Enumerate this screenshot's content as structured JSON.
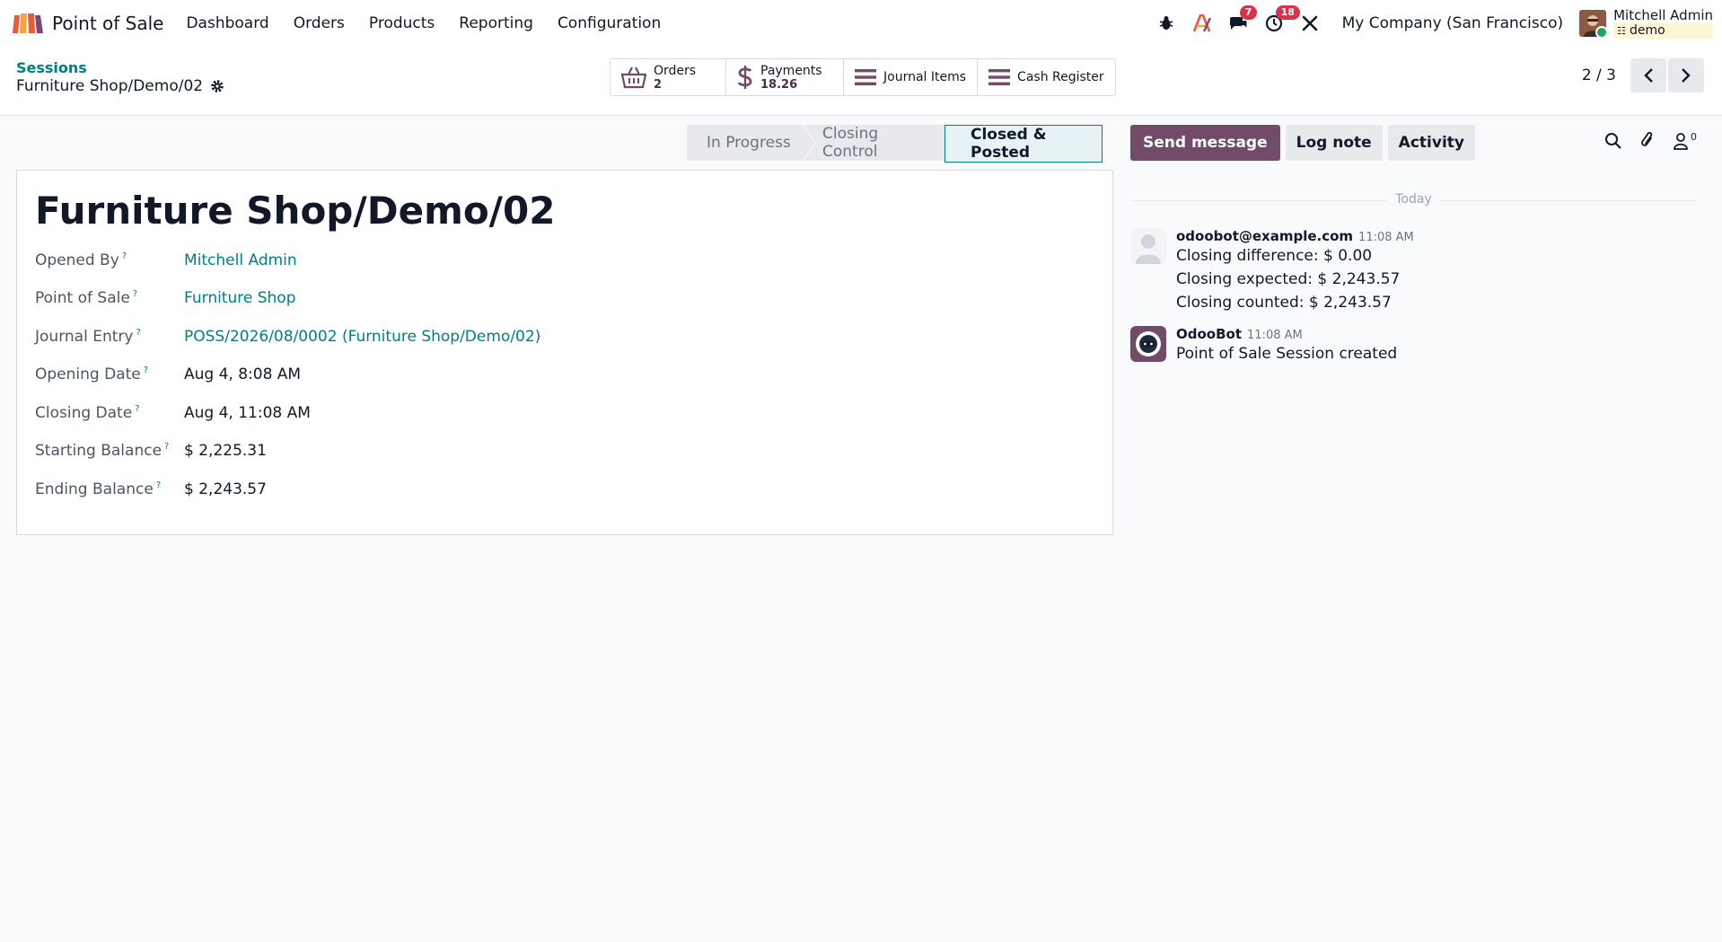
{
  "navbar": {
    "app_name": "Point of Sale",
    "menu": [
      "Dashboard",
      "Orders",
      "Products",
      "Reporting",
      "Configuration"
    ],
    "messages_badge": "7",
    "activities_badge": "18",
    "company": "My Company (San Francisco)",
    "user_name": "Mitchell Admin",
    "database": "demo"
  },
  "control_panel": {
    "breadcrumb_parent": "Sessions",
    "breadcrumb_current": "Furniture Shop/Demo/02",
    "smart_buttons": {
      "orders": {
        "label": "Orders",
        "value": "2"
      },
      "payments": {
        "label": "Payments",
        "value": "18.26"
      },
      "journal_items": {
        "label": "Journal Items"
      },
      "cash_register": {
        "label": "Cash Register"
      }
    },
    "pager": "2 / 3"
  },
  "statusbar": {
    "stages": [
      "In Progress",
      "Closing Control",
      "Closed & Posted"
    ],
    "active": "Closed & Posted"
  },
  "form": {
    "title": "Furniture Shop/Demo/02",
    "fields": {
      "opened_by": {
        "label": "Opened By",
        "value": "Mitchell Admin"
      },
      "point_of_sale": {
        "label": "Point of Sale",
        "value": "Furniture Shop"
      },
      "journal_entry": {
        "label": "Journal Entry",
        "value": "POSS/2026/08/0002 (Furniture Shop/Demo/02)"
      },
      "opening_date": {
        "label": "Opening Date",
        "value": "Aug 4, 8:08 AM"
      },
      "closing_date": {
        "label": "Closing Date",
        "value": "Aug 4, 11:08 AM"
      },
      "starting_balance": {
        "label": "Starting Balance",
        "value": "$ 2,225.31"
      },
      "ending_balance": {
        "label": "Ending Balance",
        "value": "$ 2,243.57"
      }
    },
    "help_marker": "?"
  },
  "chatter": {
    "send_message": "Send message",
    "log_note": "Log note",
    "activity": "Activity",
    "followers_count": "0",
    "date_separator": "Today",
    "messages": [
      {
        "author": "odoobot@example.com",
        "time": "11:08 AM",
        "lines": [
          "Closing difference: $ 0.00",
          "Closing expected: $ 2,243.57",
          "Closing counted: $ 2,243.57"
        ]
      },
      {
        "author": "OdooBot",
        "time": "11:08 AM",
        "lines": [
          "Point of Sale Session created"
        ]
      }
    ]
  },
  "colors": {
    "brand": "#714b67",
    "link": "#017e84",
    "badge": "#d9324a"
  }
}
